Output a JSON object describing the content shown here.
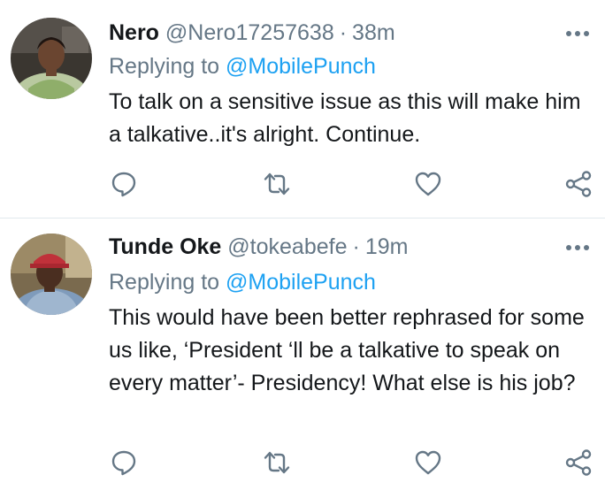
{
  "tweets": [
    {
      "display_name": "Nero",
      "handle": "@Nero17257638",
      "separator": "·",
      "time": "38m",
      "replying_prefix": "Replying to",
      "replying_to": "@MobilePunch",
      "text": "To talk on a sensitive issue as this will make him a talkative..it's alright. Continue."
    },
    {
      "display_name": "Tunde Oke",
      "handle": "@tokeabefe",
      "separator": "·",
      "time": "19m",
      "replying_prefix": "Replying to",
      "replying_to": "@MobilePunch",
      "text": "This would have been better rephrased for some us like, ‘President ‘ll be a talkative to speak on every matter’- Presidency! What else is his job?"
    }
  ],
  "icons": {
    "more": "more-horizontal-icon",
    "reply": "reply-icon",
    "retweet": "retweet-icon",
    "like": "heart-icon",
    "share": "share-icon"
  },
  "colors": {
    "text": "#14171a",
    "secondary": "#657786",
    "link": "#1da1f2",
    "divider": "#e1e8ed"
  }
}
